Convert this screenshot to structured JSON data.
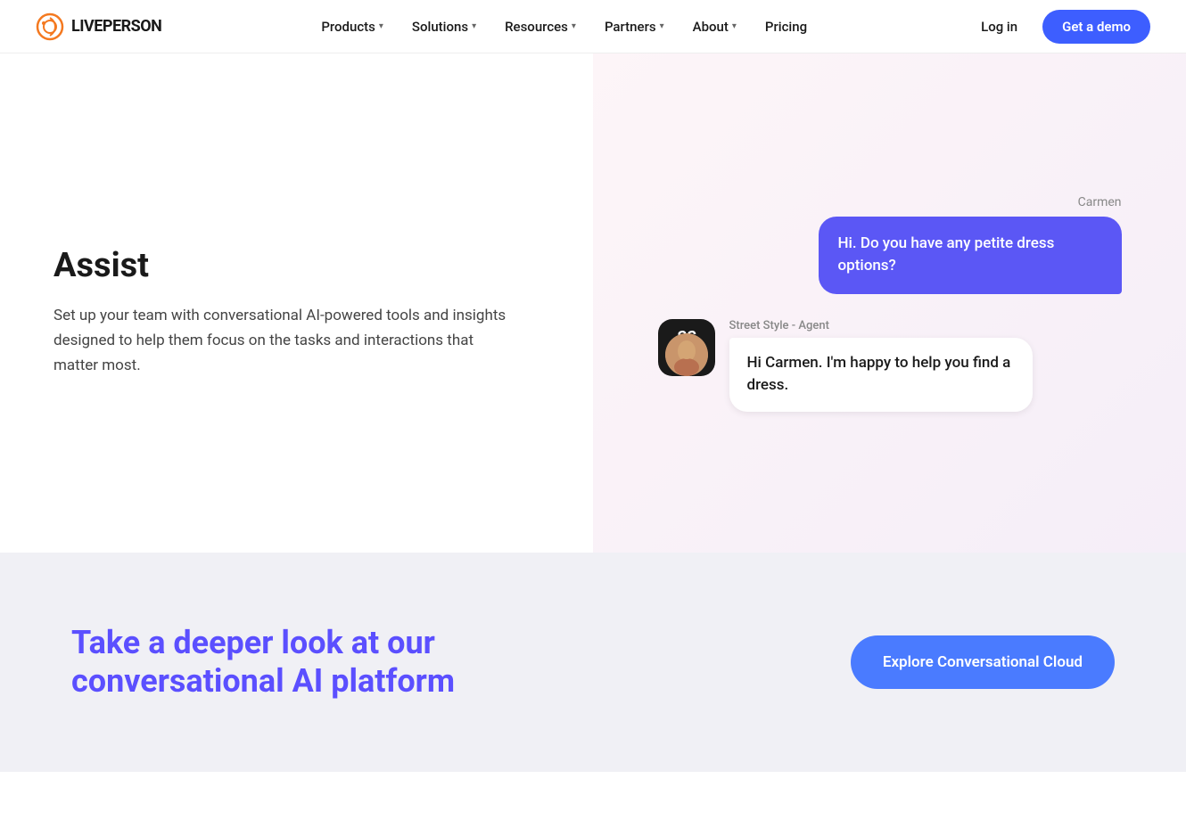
{
  "nav": {
    "logo_text": "LIVEPERSON",
    "links": [
      {
        "id": "products",
        "label": "Products",
        "has_dropdown": true
      },
      {
        "id": "solutions",
        "label": "Solutions",
        "has_dropdown": true
      },
      {
        "id": "resources",
        "label": "Resources",
        "has_dropdown": true
      },
      {
        "id": "partners",
        "label": "Partners",
        "has_dropdown": true
      },
      {
        "id": "about",
        "label": "About",
        "has_dropdown": true
      },
      {
        "id": "pricing",
        "label": "Pricing",
        "has_dropdown": false
      }
    ],
    "login_label": "Log in",
    "demo_label": "Get a demo"
  },
  "main": {
    "left": {
      "title": "Assist",
      "description": "Set up your team with conversational AI-powered tools and insights designed to help them focus on the tasks and interactions that matter most."
    },
    "chat": {
      "customer_name": "Carmen",
      "customer_message": "Hi. Do you have any petite dress options?",
      "agent_name": "Street Style - Agent",
      "agent_initials": "SS",
      "agent_message": "Hi Carmen. I'm happy to help you find a dress."
    }
  },
  "cta": {
    "heading": "Take a deeper look at our conversational AI platform",
    "button_label": "Explore Conversational Cloud"
  }
}
